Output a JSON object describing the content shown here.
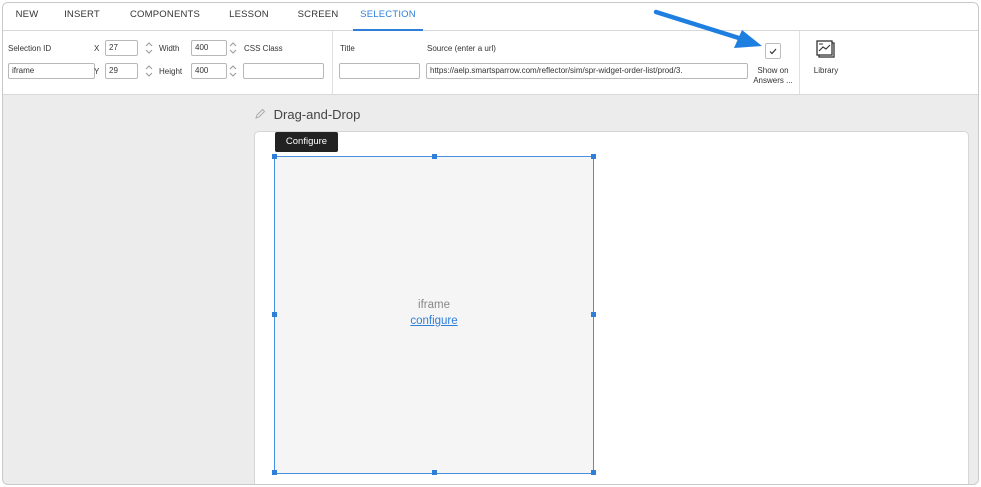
{
  "menu": {
    "tabs": [
      {
        "label": "NEW"
      },
      {
        "label": "INSERT"
      },
      {
        "label": "COMPONENTS"
      },
      {
        "label": "LESSON"
      },
      {
        "label": "SCREEN"
      },
      {
        "label": "SELECTION",
        "active": true
      }
    ]
  },
  "toolbar": {
    "selection_id_label": "Selection ID",
    "selection_id_value": "iframe",
    "x_label": "X",
    "x_value": "27",
    "y_label": "Y",
    "y_value": "29",
    "width_label": "Width",
    "width_value": "400",
    "height_label": "Height",
    "height_value": "400",
    "css_class_label": "CSS Class",
    "css_class_value": "",
    "title_label": "Title",
    "title_value": "",
    "source_label": "Source (enter a url)",
    "source_value": "https://aelp.smartsparrow.com/reflector/sim/spr-widget-order-list/prod/3.",
    "show_on_answers_line1": "Show on",
    "show_on_answers_line2": "Answers ...",
    "show_on_answers_checked": true,
    "library_label": "Library"
  },
  "canvas": {
    "screen_title": "Drag-and-Drop",
    "tooltip": "Configure",
    "iframe_label": "iframe",
    "iframe_link": "configure"
  },
  "colors": {
    "accent": "#2f7fd9",
    "annotation_arrow": "#1f7fe0"
  }
}
